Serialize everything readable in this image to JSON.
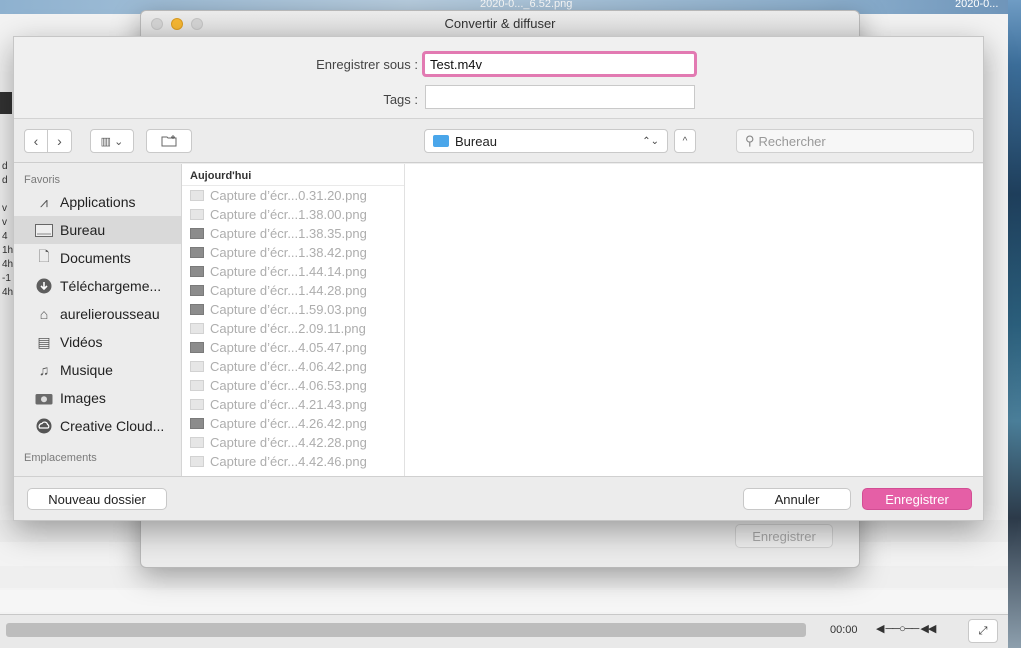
{
  "background": {
    "file_labels": [
      "2020-0..._6.52.png",
      "2020-0..."
    ],
    "time": "00:00",
    "left_letters": [
      "d",
      "d",
      "",
      "v",
      "v",
      "4",
      "1h",
      "4h",
      "-1",
      "4h"
    ]
  },
  "convert_window": {
    "title": "Convertir & diffuser",
    "save_label": "Enregistrer"
  },
  "save_sheet": {
    "save_as_label": "Enregistrer sous :",
    "filename": "Test.m4v",
    "tags_label": "Tags :",
    "location": "Bureau",
    "search_placeholder": "Rechercher"
  },
  "sidebar": {
    "favorites_heading": "Favoris",
    "places_heading": "Emplacements",
    "items": [
      {
        "label": "Applications",
        "icon": "applications-icon"
      },
      {
        "label": "Bureau",
        "icon": "desktop-icon"
      },
      {
        "label": "Documents",
        "icon": "documents-icon"
      },
      {
        "label": "Téléchargeme...",
        "icon": "download-icon"
      },
      {
        "label": "aurelierousseau",
        "icon": "home-icon"
      },
      {
        "label": "Vidéos",
        "icon": "film-icon"
      },
      {
        "label": "Musique",
        "icon": "music-icon"
      },
      {
        "label": "Images",
        "icon": "camera-icon"
      },
      {
        "label": "Creative Cloud...",
        "icon": "creative-cloud-icon"
      }
    ]
  },
  "file_column": {
    "header": "Aujourd'hui",
    "files": [
      "Capture d’écr...0.31.20.png",
      "Capture d’écr...1.38.00.png",
      "Capture d’écr...1.38.35.png",
      "Capture d’écr...1.38.42.png",
      "Capture d’écr...1.44.14.png",
      "Capture d’écr...1.44.28.png",
      "Capture d’écr...1.59.03.png",
      "Capture d’écr...2.09.11.png",
      "Capture d’écr...4.05.47.png",
      "Capture d’écr...4.06.42.png",
      "Capture d’écr...4.06.53.png",
      "Capture d’écr...4.21.43.png",
      "Capture d’écr...4.26.42.png",
      "Capture d’écr...4.42.28.png",
      "Capture d’écr...4.42.46.png"
    ]
  },
  "buttons": {
    "new_folder": "Nouveau dossier",
    "cancel": "Annuler",
    "save": "Enregistrer"
  },
  "colors": {
    "accent": "#e55fa6",
    "focus_ring": "#e27ab2",
    "folder_blue": "#4aa6ea"
  }
}
